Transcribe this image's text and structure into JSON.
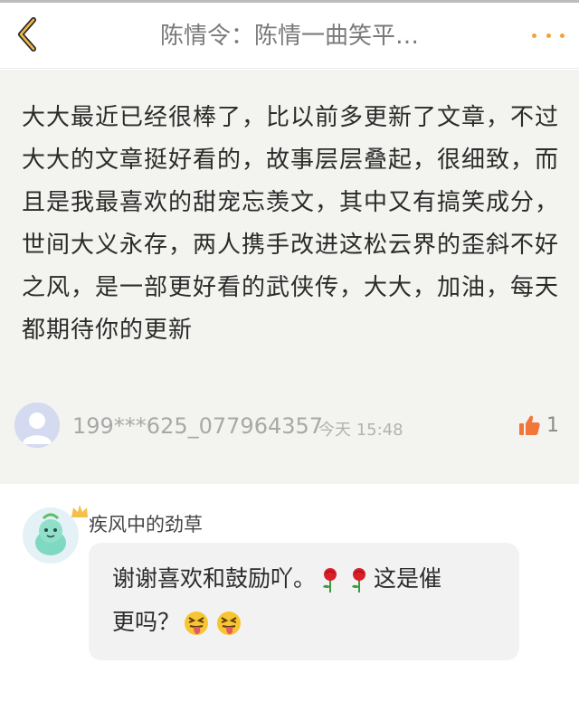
{
  "header": {
    "title": "陈情令：陈情一曲笑平…"
  },
  "comment": {
    "text": "大大最近已经很棒了，比以前多更新了文章，不过大大的文章挺好看的，故事层层叠起，很细致，而且是我最喜欢的甜宠忘羡文，其中又有搞笑成分，世间大义永存，两人携手改进这松云界的歪斜不好之风，是一部更好看的武侠传，大大，加油，每天都期待你的更新",
    "author": "199***625_077964357",
    "time": "今天 15:48",
    "likes": "1"
  },
  "reply": {
    "author": "疾风中的劲草",
    "text_part1": "谢谢喜欢和鼓励吖。",
    "text_part2": "这是催",
    "text_part3": "更吗？"
  },
  "colors": {
    "accent": "#f2a33a",
    "comment_bg": "#f3f3f0",
    "bubble_bg": "#f2f2f2"
  },
  "icons": {
    "back": "chevron-left-icon",
    "more": "more-dots-icon",
    "like": "thumbs-up-icon",
    "rose": "rose-emoji",
    "tongue": "squinting-tongue-emoji"
  }
}
